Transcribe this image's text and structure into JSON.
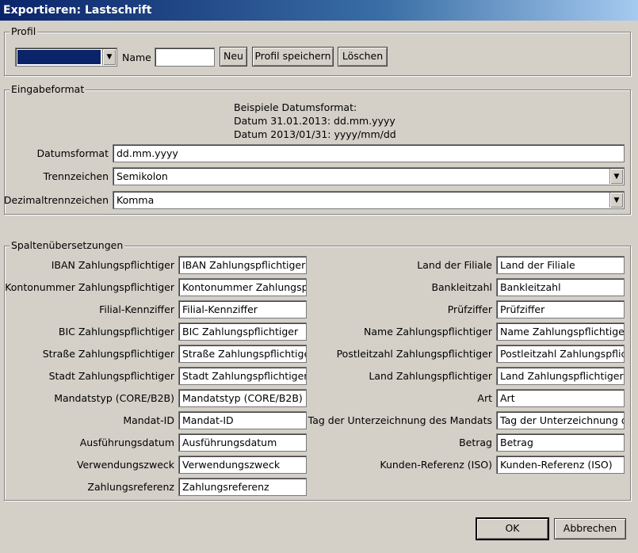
{
  "window": {
    "title": "Exportieren: Lastschrift"
  },
  "profil": {
    "legend": "Profil",
    "name_label": "Name",
    "name_value": "",
    "btn_neu": "Neu",
    "btn_speichern": "Profil speichern",
    "btn_loeschen": "Löschen",
    "combo_value": ""
  },
  "eingabe": {
    "legend": "Eingabeformat",
    "beispiel_lines": [
      "Beispiele Datumsformat:",
      "Datum 31.01.2013: dd.mm.yyyy",
      "Datum 2013/01/31: yyyy/mm/dd"
    ],
    "datumsformat_label": "Datumsformat",
    "datumsformat_value": "dd.mm.yyyy",
    "trennzeichen_label": "Trennzeichen",
    "trennzeichen_value": "Semikolon",
    "dezimal_label": "Dezimaltrennzeichen",
    "dezimal_value": "Komma"
  },
  "spalten": {
    "legend": "Spaltenübersetzungen",
    "left": [
      {
        "label": "IBAN Zahlungspflichtiger",
        "value": "IBAN Zahlungspflichtiger"
      },
      {
        "label": "Kontonummer Zahlungspflichtiger",
        "value": "Kontonummer Zahlungspflichtiger"
      },
      {
        "label": "Filial-Kennziffer",
        "value": "Filial-Kennziffer"
      },
      {
        "label": "BIC Zahlungspflichtiger",
        "value": "BIC Zahlungspflichtiger"
      },
      {
        "label": "Straße Zahlungspflichtiger",
        "value": "Straße Zahlungspflichtiger"
      },
      {
        "label": "Stadt Zahlungspflichtiger",
        "value": "Stadt Zahlungspflichtiger"
      },
      {
        "label": "Mandatstyp (CORE/B2B)",
        "value": "Mandatstyp (CORE/B2B)"
      },
      {
        "label": "Mandat-ID",
        "value": "Mandat-ID"
      },
      {
        "label": "Ausführungsdatum",
        "value": "Ausführungsdatum"
      },
      {
        "label": "Verwendungszweck",
        "value": "Verwendungszweck"
      },
      {
        "label": "Zahlungsreferenz",
        "value": "Zahlungsreferenz"
      }
    ],
    "right": [
      {
        "label": "Land der Filiale",
        "value": "Land der Filiale"
      },
      {
        "label": "Bankleitzahl",
        "value": "Bankleitzahl"
      },
      {
        "label": "Prüfziffer",
        "value": "Prüfziffer"
      },
      {
        "label": "Name Zahlungspflichtiger",
        "value": "Name Zahlungspflichtiger"
      },
      {
        "label": "Postleitzahl Zahlungspflichtiger",
        "value": "Postleitzahl Zahlungspflichtiger"
      },
      {
        "label": "Land Zahlungspflichtiger",
        "value": "Land Zahlungspflichtiger"
      },
      {
        "label": "Art",
        "value": "Art"
      },
      {
        "label": "Tag der Unterzeichnung des Mandats",
        "value": "Tag der Unterzeichnung des Mandats"
      },
      {
        "label": "Betrag",
        "value": "Betrag"
      },
      {
        "label": "Kunden-Referenz (ISO)",
        "value": "Kunden-Referenz (ISO)"
      }
    ]
  },
  "footer": {
    "ok": "OK",
    "abbrechen": "Abbrechen"
  },
  "colors": {
    "selection": "#0a246a",
    "face": "#d4d0c8",
    "title_start": "#0a246a"
  }
}
